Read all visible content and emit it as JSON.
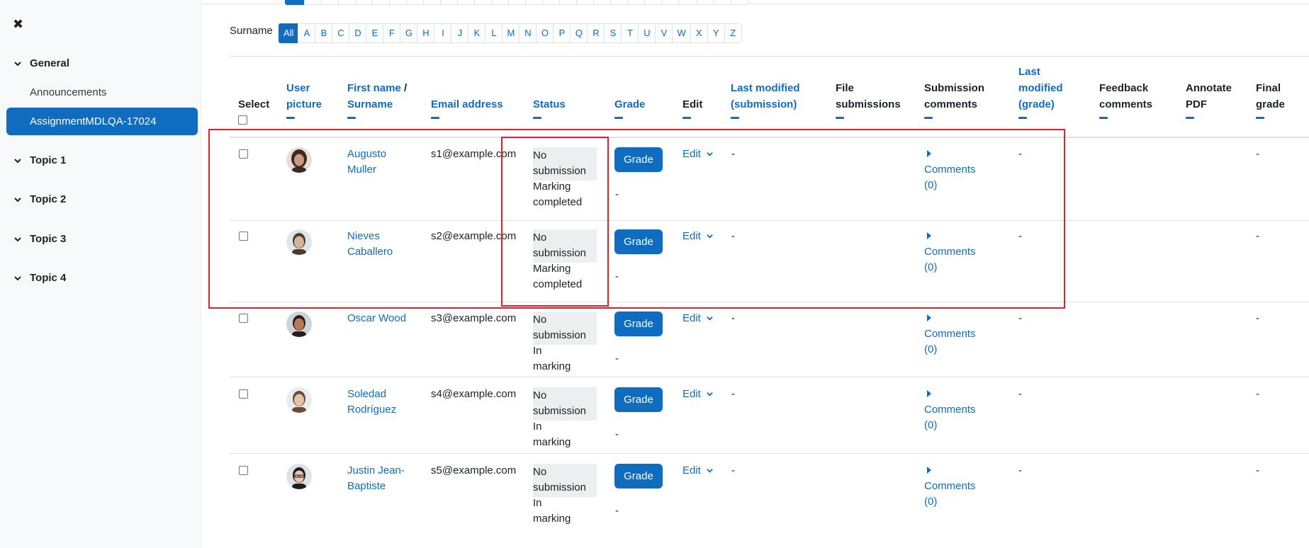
{
  "sidebar": {
    "sections": [
      {
        "label": "General"
      },
      {
        "label": "Topic 1"
      },
      {
        "label": "Topic 2"
      },
      {
        "label": "Topic 3"
      },
      {
        "label": "Topic 4"
      }
    ],
    "items": [
      {
        "label": "Announcements"
      },
      {
        "label": "AssignmentMDLQA-17024"
      }
    ]
  },
  "filters": {
    "surname_label": "Surname",
    "letters": [
      "All",
      "A",
      "B",
      "C",
      "D",
      "E",
      "F",
      "G",
      "H",
      "I",
      "J",
      "K",
      "L",
      "M",
      "N",
      "O",
      "P",
      "Q",
      "R",
      "S",
      "T",
      "U",
      "V",
      "W",
      "X",
      "Y",
      "Z"
    ]
  },
  "table": {
    "headers": {
      "select": "Select",
      "user_picture_1": "User",
      "user_picture_2": "picture",
      "first_name": "First name",
      "slash": " / ",
      "surname": "Surname",
      "email": "Email address",
      "status": "Status",
      "grade": "Grade",
      "edit": "Edit",
      "last_mod_sub_1": "Last modified",
      "last_mod_sub_2": "(submission)",
      "file_sub_1": "File",
      "file_sub_2": "submissions",
      "sub_comments_1": "Submission",
      "sub_comments_2": "comments",
      "last_mod_grade_1": "Last",
      "last_mod_grade_2": "modified",
      "last_mod_grade_3": "(grade)",
      "feedback_1": "Feedback",
      "feedback_2": "comments",
      "annotate_1": "Annotate",
      "annotate_2": "PDF",
      "final_1": "Final",
      "final_2": "grade"
    },
    "rows": [
      {
        "name1": "Augusto",
        "name2": "Muller",
        "email": "s1@example.com",
        "status1": "No",
        "status2": "submission",
        "sub1": "Marking",
        "sub2": "completed",
        "grade_btn": "Grade",
        "grade_val": "-",
        "edit": "Edit",
        "last_mod": "-",
        "comments1": "Comments",
        "comments2": "(0)",
        "last_grade": "-",
        "final": "-"
      },
      {
        "name1": "Nieves",
        "name2": "Caballero",
        "email": "s2@example.com",
        "status1": "No",
        "status2": "submission",
        "sub1": "Marking",
        "sub2": "completed",
        "grade_btn": "Grade",
        "grade_val": "-",
        "edit": "Edit",
        "last_mod": "-",
        "comments1": "Comments",
        "comments2": "(0)",
        "last_grade": "-",
        "final": "-"
      },
      {
        "name1": "Oscar Wood",
        "name2": "",
        "email": "s3@example.com",
        "status1": "No",
        "status2": "submission",
        "sub1": "In marking",
        "sub2": "",
        "grade_btn": "Grade",
        "grade_val": "-",
        "edit": "Edit",
        "last_mod": "-",
        "comments1": "Comments",
        "comments2": "(0)",
        "last_grade": "-",
        "final": "-"
      },
      {
        "name1": "Soledad",
        "name2": "Rodríguez",
        "email": "s4@example.com",
        "status1": "No",
        "status2": "submission",
        "sub1": "In marking",
        "sub2": "",
        "grade_btn": "Grade",
        "grade_val": "-",
        "edit": "Edit",
        "last_mod": "-",
        "comments1": "Comments",
        "comments2": "(0)",
        "last_grade": "-",
        "final": "-"
      },
      {
        "name1": "Justin Jean-",
        "name2": "Baptiste",
        "email": "s5@example.com",
        "status1": "No",
        "status2": "submission",
        "sub1": "In marking",
        "sub2": "",
        "grade_btn": "Grade",
        "grade_val": "-",
        "edit": "Edit",
        "last_mod": "-",
        "comments1": "Comments",
        "comments2": "(0)",
        "last_grade": "-",
        "final": "-"
      }
    ]
  },
  "colors": {
    "accent": "#0f6cbf",
    "annotation": "#d9232e"
  }
}
